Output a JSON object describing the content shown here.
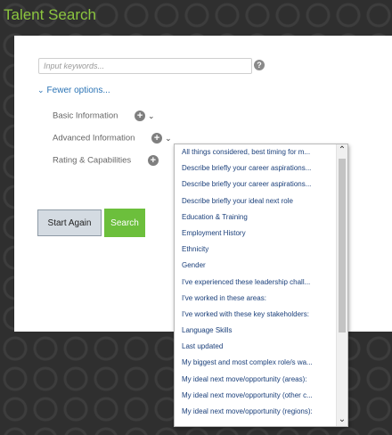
{
  "header": {
    "title": "Talent Search"
  },
  "search": {
    "placeholder": "Input keywords..."
  },
  "help": {
    "glyph": "?"
  },
  "options_toggle": {
    "label": "Fewer options..."
  },
  "option_rows": [
    {
      "label": "Basic Information"
    },
    {
      "label": "Advanced Information"
    },
    {
      "label": "Rating & Capabilities"
    }
  ],
  "buttons": {
    "start_again": "Start Again",
    "search": "Search"
  },
  "dropdown": {
    "items": [
      "All things considered, best timing for m...",
      "Describe briefly your career aspirations...",
      "Describe briefly your career aspirations...",
      "Describe briefly your ideal next role",
      "Education & Training",
      "Employment History",
      "Ethnicity",
      "Gender",
      "I've experienced these leadership chall...",
      "I've worked in these areas:",
      "I've worked with these key stakeholders:",
      "Language Skills",
      "Last updated",
      "My biggest and most complex role/s wa...",
      "My ideal next move/opportunity (areas):",
      "My ideal next move/opportunity (other c...",
      "My ideal next move/opportunity (regions):"
    ]
  },
  "colors": {
    "brand_green": "#8cc63f",
    "link_blue": "#2a73b5",
    "search_green": "#6cbf3c"
  }
}
